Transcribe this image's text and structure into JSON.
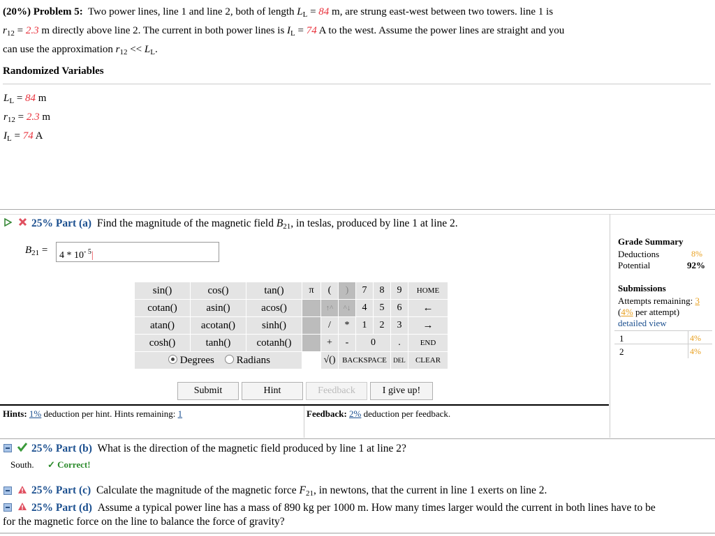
{
  "problem": {
    "header": "(20%) Problem 5:",
    "l1a": "Two power lines, line 1 and line 2, both of length ",
    "l1b": " m, are strung east-west between two towers. line 1 is",
    "l2a": " m directly above line 2. The current in both power lines is ",
    "l2b": " A to the west. Assume the power lines are straight and you",
    "l3": "can use the approximation ",
    "L_val": "84",
    "r_val": "2.3",
    "I_val": "74"
  },
  "randomized": {
    "title": "Randomized Variables",
    "L": "84",
    "L_unit": "m",
    "r": "2.3",
    "r_unit": "m",
    "I": "74",
    "I_unit": "A"
  },
  "part_a": {
    "pct": "25% Part (a)",
    "question_a": "Find the magnitude of the magnetic field ",
    "question_b": ", in teslas, produced by line 1 at line 2.",
    "answer_base": "4 * 10",
    "answer_exp": "- 5",
    "calc": {
      "fn_rows": [
        [
          "sin()",
          "cos()",
          "tan()"
        ],
        [
          "cotan()",
          "asin()",
          "acos()"
        ],
        [
          "atan()",
          "acotan()",
          "sinh()"
        ],
        [
          "cosh()",
          "tanh()",
          "cotanh()"
        ]
      ],
      "degrees": "Degrees",
      "radians": "Radians",
      "pi": "π",
      "lparen": "(",
      "rparen": ")",
      "home": "HOME",
      "left": "←",
      "right": "→",
      "end": "END",
      "backspace": "BACKSPACE",
      "del": "DEL",
      "clear": "CLEAR",
      "sqrt": "√()",
      "up": "↑^",
      "uparr": "^↓",
      "slash": "/",
      "star": "*",
      "plus": "+",
      "minus": "-",
      "dot": ".",
      "digits": [
        "7",
        "8",
        "9",
        "4",
        "5",
        "6",
        "1",
        "2",
        "3",
        "0"
      ]
    },
    "buttons": {
      "submit": "Submit",
      "hint": "Hint",
      "feedback": "Feedback",
      "giveup": "I give up!"
    },
    "hints_label": "Hints:",
    "hints_pct": "1%",
    "hints_text": " deduction per hint. Hints remaining: ",
    "hints_remaining": "1",
    "feedback_label": "Feedback:",
    "feedback_pct": "2%",
    "feedback_text": " deduction per feedback."
  },
  "grade": {
    "title": "Grade Summary",
    "deductions_label": "Deductions",
    "deductions": "8%",
    "potential_label": "Potential",
    "potential": "92%",
    "submissions_title": "Submissions",
    "attempts_label": "Attempts remaining: ",
    "attempts": "3",
    "per_attempt_pct": "4%",
    "per_attempt_text": " per attempt)",
    "detailed": "detailed view",
    "rows": [
      {
        "n": "1",
        "pct": "4%"
      },
      {
        "n": "2",
        "pct": "4%"
      }
    ]
  },
  "part_b": {
    "pct": "25% Part (b)",
    "question": "What is the direction of the magnetic field produced by line 1 at line 2?",
    "answer": "South.",
    "status": "✓ Correct!"
  },
  "part_c": {
    "pct": "25% Part (c)",
    "question_a": "Calculate the magnitude of the magnetic force ",
    "question_b": ", in newtons, that the current in line 1 exerts on line 2."
  },
  "part_d": {
    "pct": "25% Part (d)",
    "question_1": "Assume a typical power line has a mass of 890 kg per 1000 m. How many times larger would the current in both lines have to be",
    "question_2": "for the magnetic force on the line to balance the force of gravity?"
  },
  "colors": {
    "accent": "#1b4f8f",
    "variable": "#e8323c",
    "percent": "#e8a020",
    "correct": "#2a8a2a"
  }
}
